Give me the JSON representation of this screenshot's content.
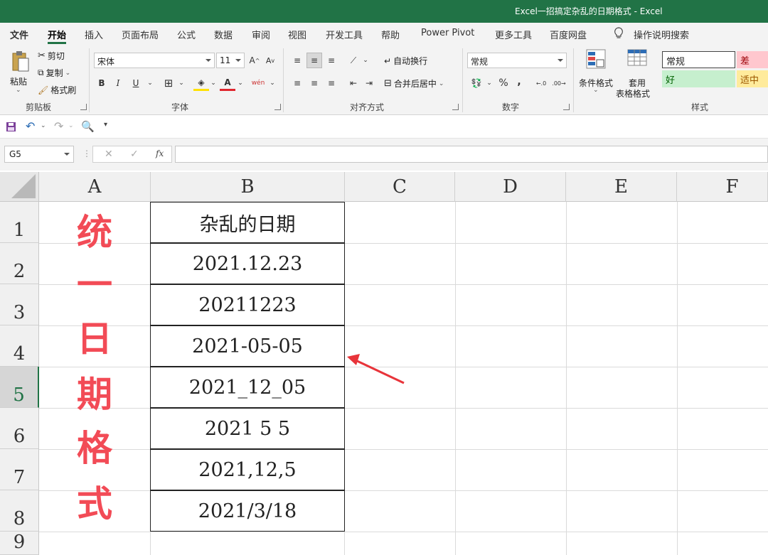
{
  "window": {
    "title": "Excel一招搞定杂乱的日期格式  -  Excel"
  },
  "tabs": [
    {
      "label": "文件"
    },
    {
      "label": "开始"
    },
    {
      "label": "插入"
    },
    {
      "label": "页面布局"
    },
    {
      "label": "公式"
    },
    {
      "label": "数据"
    },
    {
      "label": "审阅"
    },
    {
      "label": "视图"
    },
    {
      "label": "开发工具"
    },
    {
      "label": "帮助"
    },
    {
      "label": "Power Pivot"
    },
    {
      "label": "更多工具"
    },
    {
      "label": "百度网盘"
    },
    {
      "label": "操作说明搜索"
    }
  ],
  "ribbon": {
    "clipboard": {
      "paste": "粘贴",
      "cut": "剪切",
      "copy": "复制",
      "painter": "格式刷",
      "label": "剪贴板"
    },
    "font": {
      "name": "宋体",
      "size": "11",
      "label": "字体",
      "bold": "B",
      "italic": "I",
      "underline": "U",
      "phonetic": "wén"
    },
    "align": {
      "wrap": "自动换行",
      "merge": "合并后居中",
      "label": "对齐方式"
    },
    "number": {
      "format": "常规",
      "percent": "%",
      "comma": ",",
      "label": "数字"
    },
    "styles": {
      "cond": "条件格式",
      "table1": "套用",
      "table2": "表格格式",
      "label": "样式",
      "normal": "常规",
      "bad": "差",
      "good": "好",
      "neutral": "适中"
    }
  },
  "formula_bar": {
    "cell_ref": "G5",
    "formula": ""
  },
  "sheet": {
    "columns": [
      "A",
      "B",
      "C",
      "D",
      "E",
      "F"
    ],
    "rows": [
      "1",
      "2",
      "3",
      "4",
      "5",
      "6",
      "7",
      "8",
      "9"
    ],
    "selected_row": "5",
    "column_a_text": [
      "统",
      "一",
      "日",
      "期",
      "格",
      "式"
    ],
    "column_b": [
      "杂乱的日期",
      "2021.12.23",
      "20211223",
      "2021-05-05",
      "2021_12_05",
      "2021 5 5",
      "2021,12,5",
      "2021/3/18"
    ]
  },
  "colors": {
    "accent": "#217346",
    "highlight_text": "#f24b56",
    "arrow": "#e8343a"
  }
}
